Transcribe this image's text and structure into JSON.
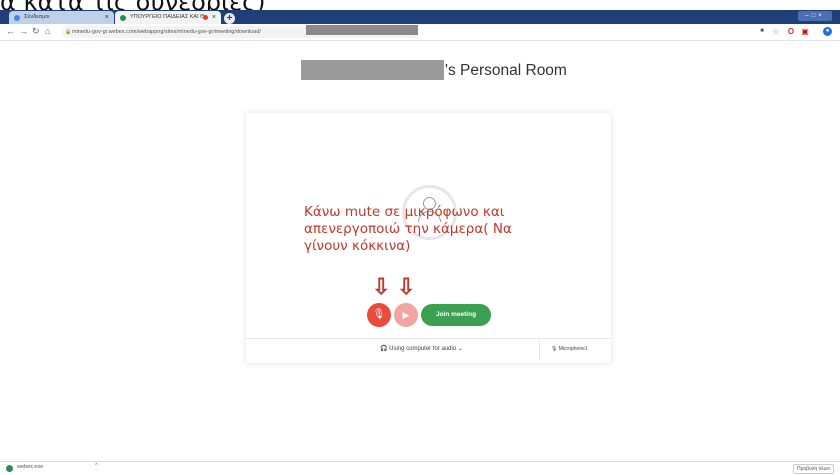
{
  "doc_title": "α κατά τις συνεδρίες)",
  "tabs": [
    {
      "label": "Σύνδεσμοι"
    },
    {
      "label": "ΥΠΟΥΡΓΕΙΟ ΠΑΙΔΕΙΑΣ ΚΑΙ Θ"
    }
  ],
  "browser": {
    "url": "minedu-gov-gr.webex.com/webappng/sites/minedu-gov-gr/meeting/download/"
  },
  "meeting": {
    "title_suffix": "'s Personal Room",
    "join_label": "Join meeting",
    "audio_label": "Using computer for audio",
    "microphone_label": "Microphone1"
  },
  "annotation": {
    "text": "Κάνω mute σε μικρόφωνο και απενεργοποιώ την κάμερα( Να γίνουν κόκκινα)"
  },
  "downloads": {
    "file_name": "webex.exe",
    "show_all": "Προβολή όλων"
  },
  "colors": {
    "accent_red": "#c0392b",
    "join_green": "#3ba150",
    "tabstrip": "#1f3f78"
  }
}
